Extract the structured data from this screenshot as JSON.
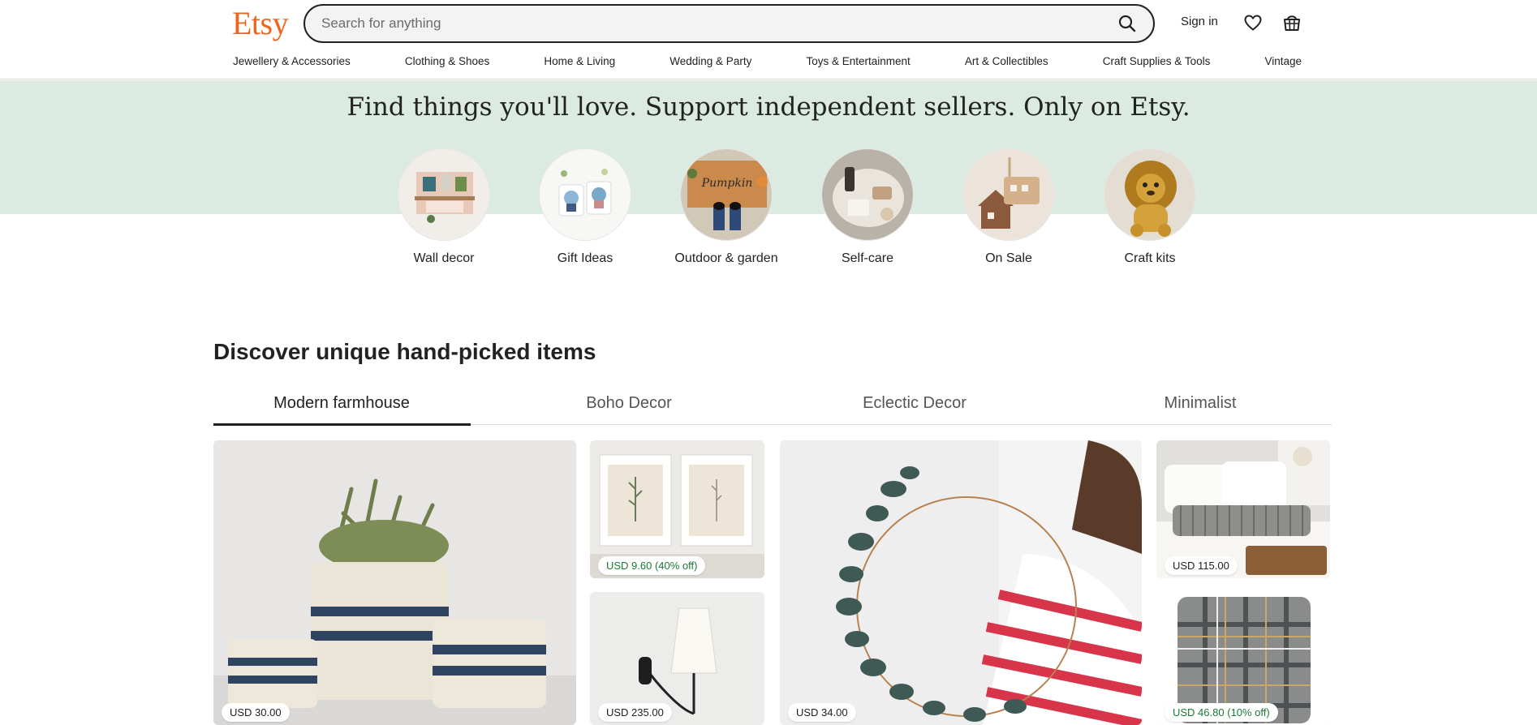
{
  "header": {
    "logo": "Etsy",
    "search_placeholder": "Search for anything",
    "sign_in": "Sign in",
    "icons": [
      "search-icon",
      "heart-icon",
      "basket-icon"
    ]
  },
  "nav": {
    "categories": [
      "Jewellery & Accessories",
      "Clothing & Shoes",
      "Home & Living",
      "Wedding & Party",
      "Toys & Entertainment",
      "Art & Collectibles",
      "Craft Supplies & Tools",
      "Vintage"
    ]
  },
  "hero": {
    "title": "Find things you'll love. Support independent sellers. Only on Etsy.",
    "background": "#dcebe1",
    "circles": [
      {
        "label": "Wall decor"
      },
      {
        "label": "Gift Ideas"
      },
      {
        "label": "Outdoor & garden"
      },
      {
        "label": "Self-care"
      },
      {
        "label": "On Sale"
      },
      {
        "label": "Craft kits"
      }
    ]
  },
  "discover": {
    "title": "Discover unique hand-picked items",
    "tabs": [
      {
        "label": "Modern farmhouse",
        "active": true
      },
      {
        "label": "Boho Decor",
        "active": false
      },
      {
        "label": "Eclectic Decor",
        "active": false
      },
      {
        "label": "Minimalist",
        "active": false
      }
    ],
    "products": [
      {
        "price": "USD 30.00",
        "sale": false
      },
      {
        "price": "USD 9.60 (40% off)",
        "sale": true
      },
      {
        "price": "USD 235.00",
        "sale": false
      },
      {
        "price": "USD 34.00",
        "sale": false
      },
      {
        "price": "USD 115.00",
        "sale": false
      },
      {
        "price": "USD 46.80 (10% off)",
        "sale": true
      }
    ]
  },
  "colors": {
    "brand": "#F1641E",
    "sale_price": "#1b7b35"
  }
}
